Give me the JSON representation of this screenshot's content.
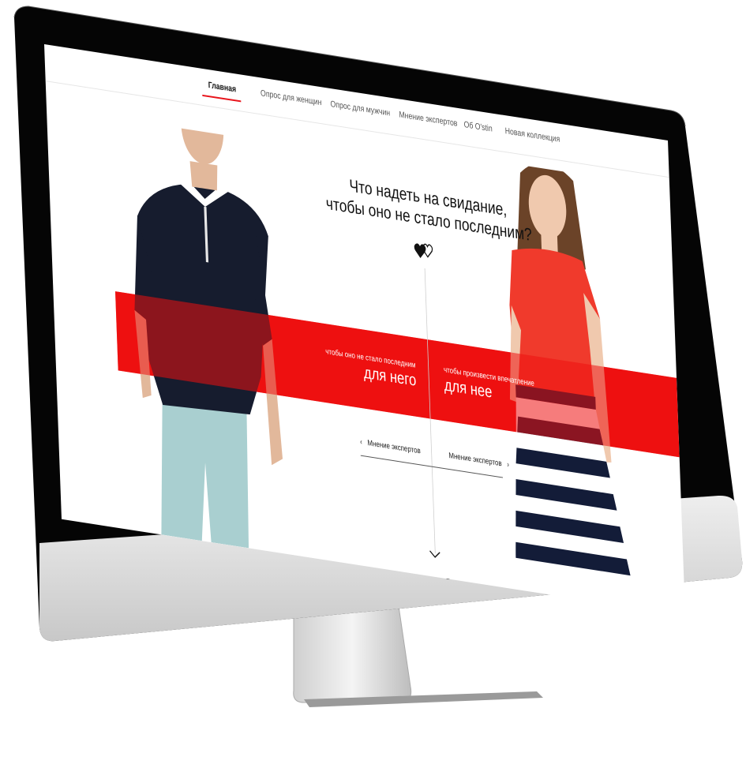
{
  "nav": {
    "items": [
      {
        "label": "Главная",
        "active": true
      },
      {
        "label": "Опрос для женщин",
        "active": false
      },
      {
        "label": "Опрос для мужчин",
        "active": false
      },
      {
        "label": "Мнение экспертов",
        "active": false
      },
      {
        "label": "Об O'stin",
        "active": false
      },
      {
        "label": "Новая коллекция",
        "active": false
      }
    ]
  },
  "hero": {
    "headline_line1": "Что надеть на свидание,",
    "headline_line2": "чтобы оно не стало последним?",
    "hearts_icon": "hearts-icon",
    "left_choice": {
      "small": "чтобы оно не стало последним",
      "big": "для него"
    },
    "right_choice": {
      "small": "чтобы произвести впечатление",
      "big": "для нее"
    },
    "expert_left": "Мнение экспертов",
    "expert_right": "Мнение экспертов",
    "scroll_icon": "chevron-down-icon"
  },
  "colors": {
    "accent": "#ee1111",
    "text": "#111111",
    "monitor_bezel": "#000000",
    "monitor_body": "#d9d9d9"
  },
  "device": {
    "logo_icon": "apple-logo-icon"
  }
}
